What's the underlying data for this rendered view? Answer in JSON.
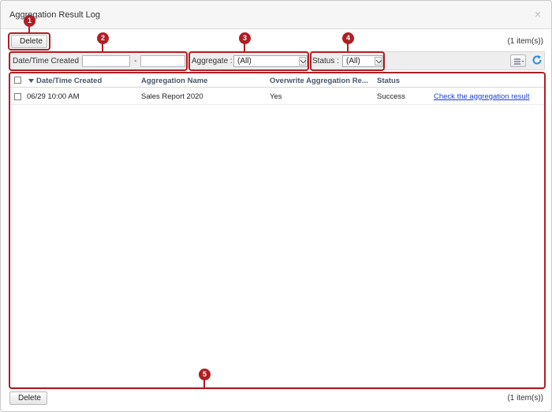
{
  "dialog": {
    "title": "Aggregation Result Log",
    "close_label": "×"
  },
  "toolbar_top": {
    "delete_label": "Delete",
    "count": "(1 item(s))"
  },
  "filters": {
    "date_label": "Date/Time Created :",
    "date_from": "",
    "date_separator": "-",
    "date_to": "",
    "aggregate_label": "Aggregate :",
    "aggregate_value": "(All)",
    "status_label": "Status :",
    "status_value": "(All)"
  },
  "table": {
    "columns": [
      "Date/Time Created",
      "Aggregation Name",
      "Overwrite Aggregation Re...",
      "Status"
    ],
    "sort_column": "Date/Time Created",
    "rows": [
      {
        "date": "06/29 10:00 AM",
        "name": "Sales Report 2020",
        "overwrite": "Yes",
        "status": "Success",
        "link": "Check the aggregation result"
      }
    ]
  },
  "toolbar_bottom": {
    "delete_label": "Delete",
    "count": "(1 item(s))"
  },
  "callouts": [
    "1",
    "2",
    "3",
    "4",
    "5"
  ],
  "colors": {
    "callout": "#b01e23",
    "link": "#1a3fd6",
    "refresh": "#2a8fd6"
  },
  "icons": {
    "column_menu": "list-menu-icon",
    "refresh": "refresh-icon",
    "sort": "sort-desc-icon"
  }
}
